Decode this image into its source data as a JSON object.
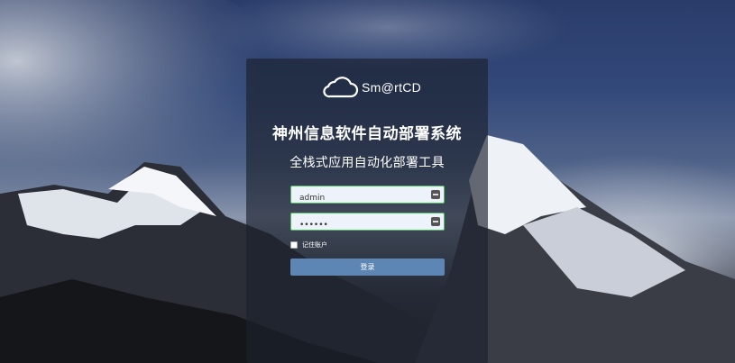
{
  "brand": {
    "logo_text": "Sm@rtCD",
    "logo_icon": "cloud-icon"
  },
  "header": {
    "title": "神州信息软件自动部署系统",
    "subtitle": "全栈式应用自动化部署工具"
  },
  "form": {
    "username_value": "admin",
    "password_value": "••••••",
    "field_icon": "key-icon",
    "remember_label": "记住账户",
    "remember_checked": false,
    "submit_label": "登录"
  },
  "colors": {
    "accent": "#5d86b4",
    "field_border": "#4cc15f",
    "panel": "#1c222e"
  }
}
